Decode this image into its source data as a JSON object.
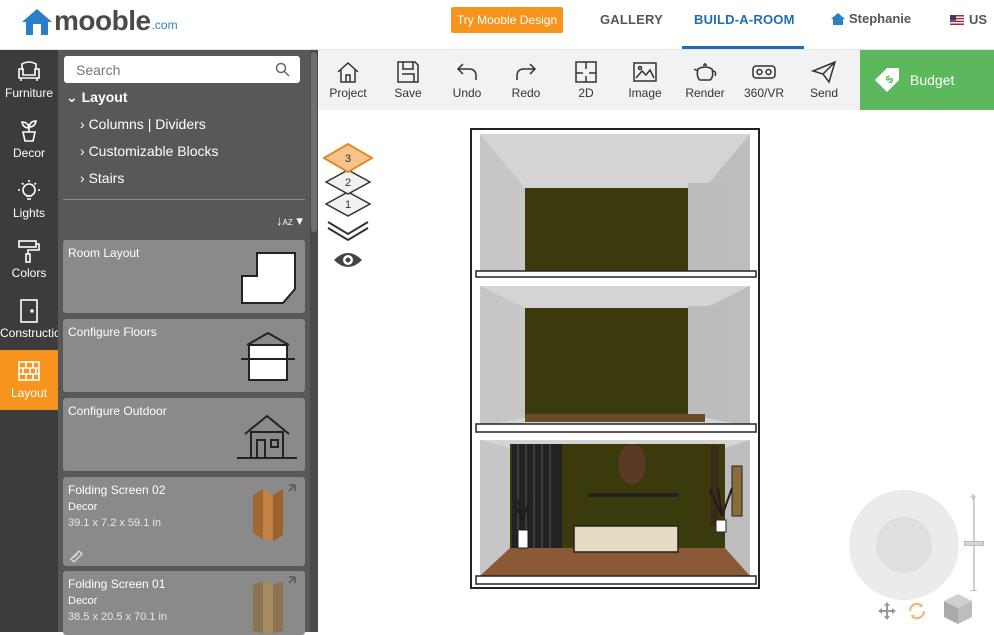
{
  "brand": {
    "name": "mooble",
    "suffix": ".com",
    "accent": "#2b7ec9"
  },
  "header": {
    "try_button": "Try Mooble Design",
    "nav": [
      "GALLERY",
      "BUILD-A-ROOM"
    ],
    "active_nav": "BUILD-A-ROOM",
    "user": "Stephanie",
    "language": "US"
  },
  "categories": [
    {
      "label": "Furniture",
      "icon": "armchair-icon"
    },
    {
      "label": "Decor",
      "icon": "plant-icon"
    },
    {
      "label": "Lights",
      "icon": "bulb-icon"
    },
    {
      "label": "Colors",
      "icon": "paint-roller-icon"
    },
    {
      "label": "Construction",
      "icon": "door-icon"
    },
    {
      "label": "Layout",
      "icon": "brick-wall-icon",
      "active": true
    }
  ],
  "panel": {
    "search_placeholder": "Search",
    "tree_head": "Layout",
    "tree_items": [
      "Columns | Dividers",
      "Customizable Blocks",
      "Stairs"
    ],
    "cards": [
      {
        "title": "Room Layout"
      },
      {
        "title": "Configure Floors"
      },
      {
        "title": "Configure Outdoor"
      },
      {
        "title": "Folding Screen 02",
        "category": "Decor",
        "dims": "39.1 x 7.2 x 59.1 in"
      },
      {
        "title": "Folding Screen 01",
        "category": "Decor",
        "dims": "38.5 x 20.5 x 70.1 in"
      }
    ]
  },
  "toolbar": [
    "Project",
    "Save",
    "Undo",
    "Redo",
    "2D",
    "Image",
    "Render",
    "360/VR",
    "Send"
  ],
  "budget": {
    "label": "Budget",
    "color": "#5cb85c"
  },
  "levels": {
    "items": [
      "3",
      "2",
      "1"
    ],
    "active": "3"
  },
  "colors": {
    "orange": "#f7941d",
    "sidebar": "#3c3c3c",
    "panel": "#585858",
    "wall": "#3a3a0c"
  }
}
